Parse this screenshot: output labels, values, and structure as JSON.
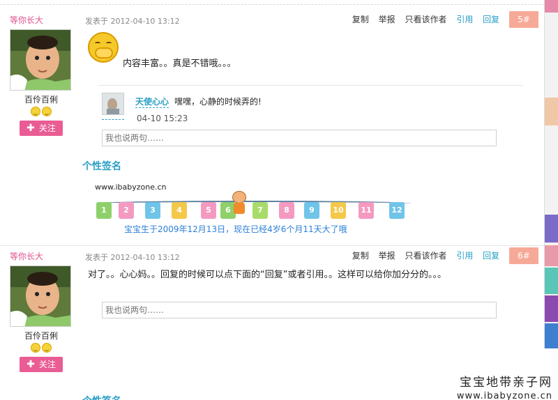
{
  "posts": [
    {
      "username": "等你长大",
      "user_title": "百伶百俐",
      "follow_label": "关注",
      "time": "发表于 2012-04-10 13:12",
      "actions": [
        "复制",
        "举报",
        "只看该作者",
        "引用",
        "回复"
      ],
      "floor": "5#",
      "content": "内容丰富。。真是不错哦。。。",
      "reply": {
        "user": "天使心心",
        "text": "嘿嘿，心静的时候弄的!",
        "time": "04-10 15:23"
      },
      "reply_placeholder": "我也说两句……",
      "signature_title": "个性签名",
      "signature": {
        "url": "www.ibabyzone.cn",
        "numbers": [
          "1",
          "2",
          "3",
          "4",
          "5",
          "6",
          "7",
          "8",
          "9",
          "10",
          "11",
          "12"
        ],
        "caption": "宝宝生于2009年12月13日，现在已经4岁6个月11天大了哦"
      }
    },
    {
      "username": "等你长大",
      "user_title": "百伶百俐",
      "follow_label": "关注",
      "time": "发表于 2012-04-10 13:12",
      "actions": [
        "复制",
        "举报",
        "只看该作者",
        "引用",
        "回复"
      ],
      "floor": "6#",
      "content": "对了。。心心妈。。回复的时候可以点下面的“回复”或者引用。。这样可以给你加分分的。。。",
      "reply_placeholder": "我也说两句……",
      "signature_title": "个性签名"
    }
  ],
  "watermark": {
    "site_name": "宝宝地带亲子网",
    "url": "www.ibabyzone.cn"
  },
  "colors": {
    "username": "#e0538f",
    "link_blue": "#2a9fc6",
    "follow_button": "#e95c94",
    "floor_badge": "#f7a998"
  }
}
